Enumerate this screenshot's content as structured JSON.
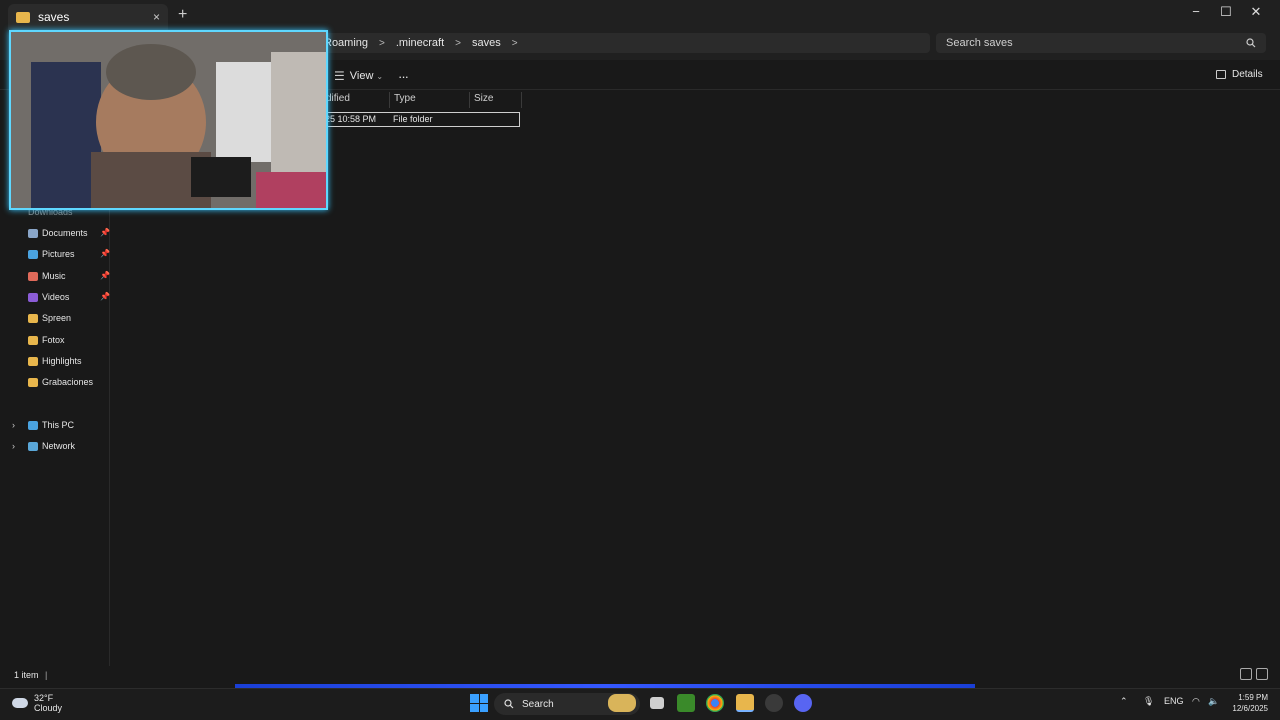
{
  "window": {
    "tab_title": "saves",
    "close": "×",
    "new_tab": "+",
    "minimize": "−",
    "maximize": "☐",
    "close_window": "✕"
  },
  "address": {
    "crumbs": [
      "Roaming",
      ".minecraft",
      "saves"
    ],
    "separator": ">",
    "search_placeholder": "Search saves"
  },
  "toolbar": {
    "view_label": "View",
    "more": "···",
    "details_label": "Details"
  },
  "columns": {
    "modified": "dified",
    "type": "Type",
    "size": "Size"
  },
  "row": {
    "modified": "25 10:58 PM",
    "type": "File folder"
  },
  "sidebar": {
    "downloads": "Downloads",
    "items": [
      {
        "label": "Documents",
        "color": "#8aa6c9",
        "pinned": true
      },
      {
        "label": "Pictures",
        "color": "#4aa3e0",
        "pinned": true
      },
      {
        "label": "Music",
        "color": "#e06a5a",
        "pinned": true
      },
      {
        "label": "Videos",
        "color": "#8b5cd6",
        "pinned": true
      },
      {
        "label": "Spreen",
        "color": "#e8b64c",
        "pinned": false
      },
      {
        "label": "Fotox",
        "color": "#e8b64c",
        "pinned": false
      },
      {
        "label": "Highlights",
        "color": "#e8b64c",
        "pinned": false
      },
      {
        "label": "Grabaciones",
        "color": "#e8b64c",
        "pinned": false
      }
    ],
    "this_pc": "This PC",
    "network": "Network"
  },
  "status": {
    "count": "1 item"
  },
  "taskbar": {
    "temp": "32°F",
    "condition": "Cloudy",
    "search": "Search",
    "lang": "ENG",
    "time": "1:59 PM",
    "date": "12/6/2025"
  }
}
